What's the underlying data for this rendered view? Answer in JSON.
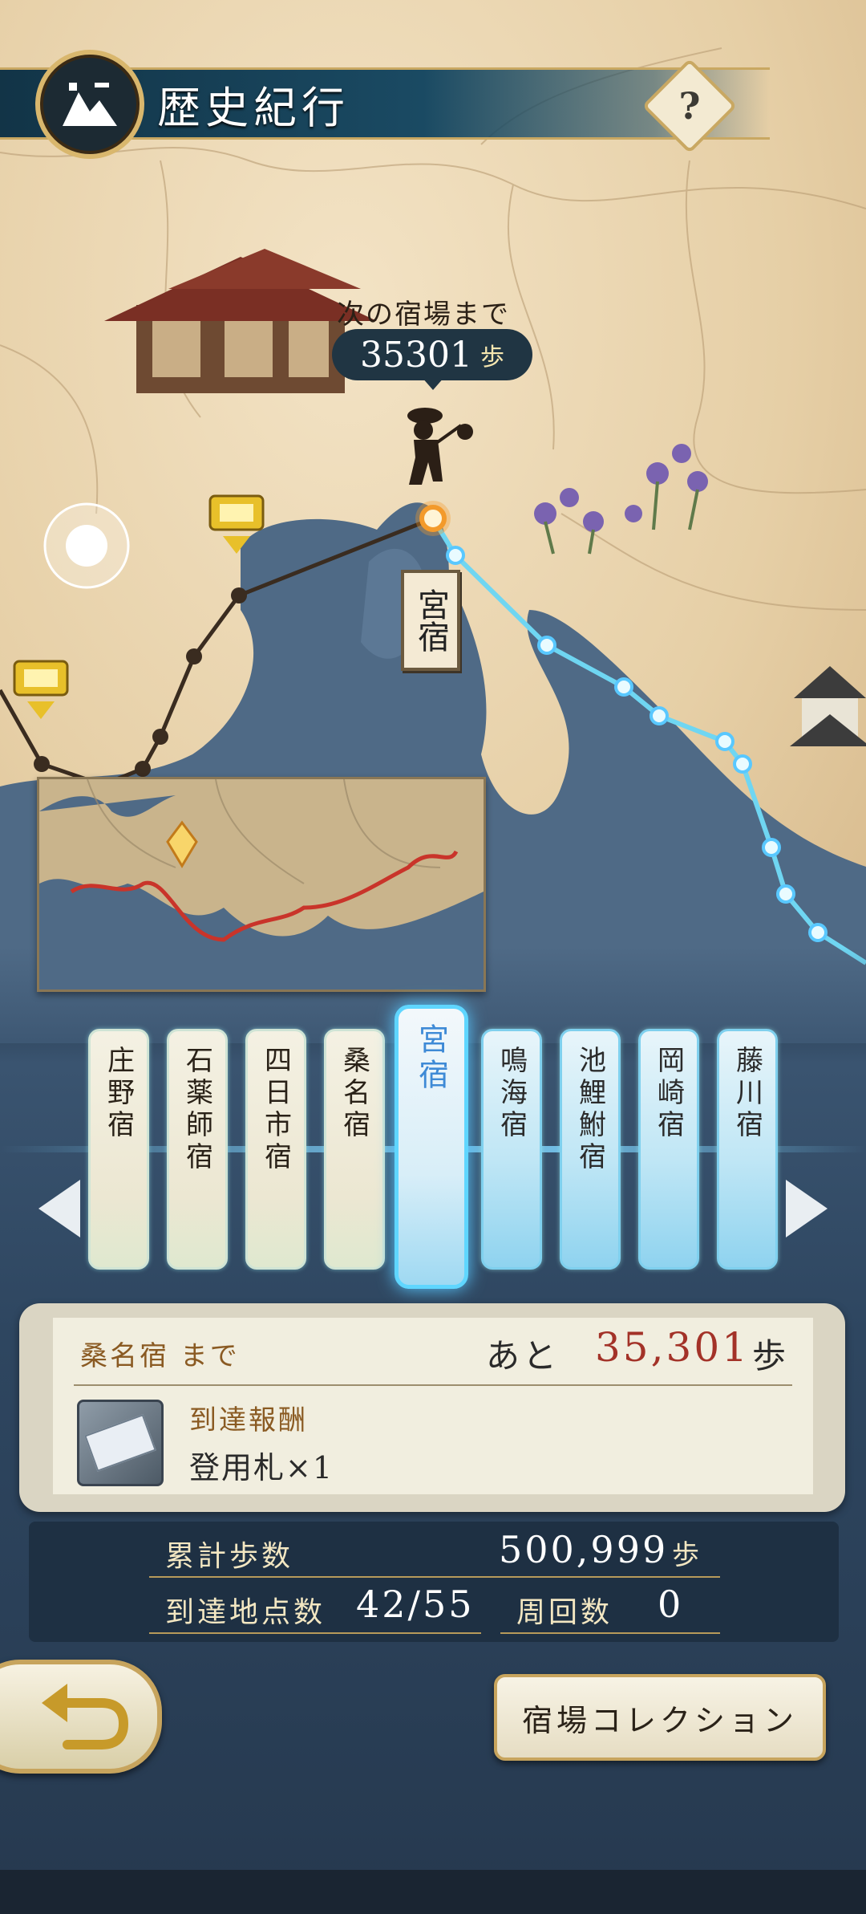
{
  "header": {
    "title": "歴史紀行",
    "help_label": "?"
  },
  "map": {
    "next_stage_label": "次の宿場まで",
    "steps_remaining": "35301",
    "steps_unit": "歩",
    "current_station_sign": "宮宿"
  },
  "carousel": {
    "stations": [
      {
        "name": "庄野宿",
        "state": "past"
      },
      {
        "name": "石薬師宿",
        "state": "past"
      },
      {
        "name": "四日市宿",
        "state": "past"
      },
      {
        "name": "桑名宿",
        "state": "past"
      },
      {
        "name": "宮宿",
        "state": "current"
      },
      {
        "name": "鳴海宿",
        "state": "future"
      },
      {
        "name": "池鯉鮒宿",
        "state": "future"
      },
      {
        "name": "岡崎宿",
        "state": "future"
      },
      {
        "name": "藤川宿",
        "state": "future"
      }
    ]
  },
  "info": {
    "destination_label": "桑名宿 まで",
    "remaining_prefix": "あと",
    "remaining_value": "35,301",
    "remaining_unit": "歩",
    "reward_label": "到達報酬",
    "reward_item": "登用札×1"
  },
  "stats": {
    "total_steps_label": "累計歩数",
    "total_steps_value": "500,999",
    "total_steps_unit": "歩",
    "reached_label": "到達地点数",
    "reached_value": "42/55",
    "laps_label": "周回数",
    "laps_value": "0"
  },
  "buttons": {
    "collection_label": "宿場コレクション"
  },
  "colors": {
    "route_traveled": "#3a2c20",
    "route_future": "#6fd6f2",
    "accent_red": "#a33228",
    "current_node": "#f39a2b"
  }
}
